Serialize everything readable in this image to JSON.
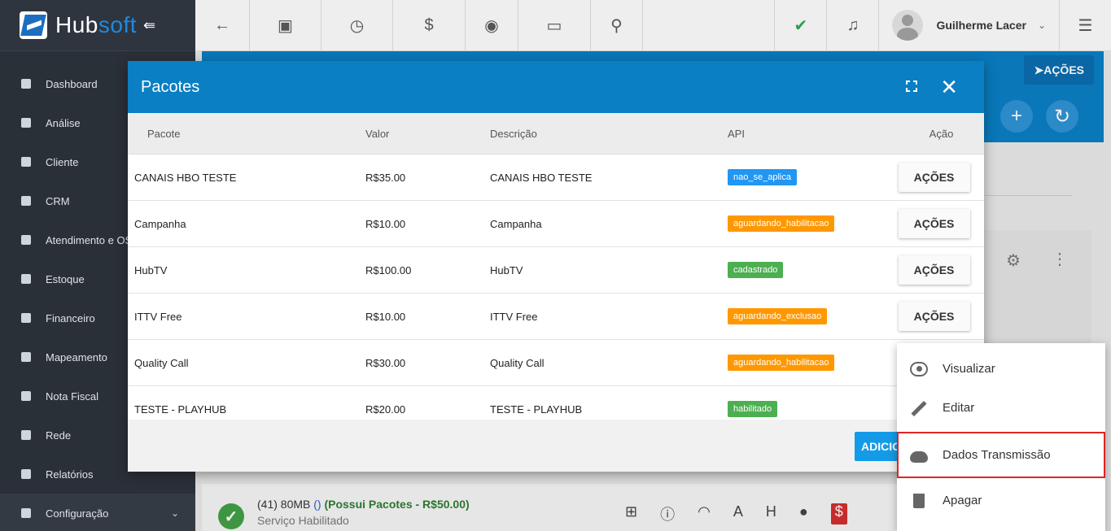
{
  "brand": {
    "name_part1": "Hub",
    "name_part2": "soft",
    "collapse_icon": "⇚"
  },
  "sidebar": {
    "items": [
      {
        "label": "Dashboard",
        "icon": "dashboard-icon"
      },
      {
        "label": "Análise",
        "icon": "pie-chart-icon"
      },
      {
        "label": "Cliente",
        "icon": "contact-card-icon"
      },
      {
        "label": "CRM",
        "icon": "crm-board-icon"
      },
      {
        "label": "Atendimento e OS",
        "icon": "calendar-clock-icon"
      },
      {
        "label": "Estoque",
        "icon": "box-icon"
      },
      {
        "label": "Financeiro",
        "icon": "money-icon"
      },
      {
        "label": "Mapeamento",
        "icon": "map-pin-icon"
      },
      {
        "label": "Nota Fiscal",
        "icon": "document-icon"
      },
      {
        "label": "Rede",
        "icon": "server-icon"
      },
      {
        "label": "Relatórios",
        "icon": "report-icon"
      },
      {
        "label": "Configuração",
        "icon": "gear-icon"
      }
    ]
  },
  "topbar": {
    "user_name": "Guilherme Lacer",
    "icons": {
      "back": "←",
      "contact": "▣",
      "calendar": "◷",
      "money": "$",
      "eye": "◉",
      "terminal": "▭",
      "search": "⚲",
      "check": "✔",
      "bell": "♫",
      "menu": "☰",
      "caret": "⌄"
    }
  },
  "background": {
    "acoes_label": "AÇÕES",
    "service": {
      "title_main": "(41) 80MB",
      "title_paren": "()",
      "title_packages": "(Possui Pacotes - R$50.00)",
      "subtitle": "Serviço Habilitado"
    }
  },
  "modal": {
    "title": "Pacotes",
    "columns": [
      "Pacote",
      "Valor",
      "Descrição",
      "API",
      "Ação"
    ],
    "rows": [
      {
        "pacote": "CANAIS HBO TESTE",
        "valor": "R$35.00",
        "descricao": "CANAIS HBO TESTE",
        "api": "nao_se_aplica",
        "api_color": "#2196f3",
        "acao": "AÇÕES"
      },
      {
        "pacote": "Campanha",
        "valor": "R$10.00",
        "descricao": "Campanha",
        "api": "aguardando_habilitacao",
        "api_color": "#ff9800",
        "acao": "AÇÕES"
      },
      {
        "pacote": "HubTV",
        "valor": "R$100.00",
        "descricao": "HubTV",
        "api": "cadastrado",
        "api_color": "#4caf50",
        "acao": "AÇÕES"
      },
      {
        "pacote": "ITTV Free",
        "valor": "R$10.00",
        "descricao": "ITTV Free",
        "api": "aguardando_exclusao",
        "api_color": "#ff9800",
        "acao": "AÇÕES"
      },
      {
        "pacote": "Quality Call",
        "valor": "R$30.00",
        "descricao": "Quality Call",
        "api": "aguardando_habilitacao",
        "api_color": "#ff9800",
        "acao": ""
      },
      {
        "pacote": "TESTE - PLAYHUB",
        "valor": "R$20.00",
        "descricao": "TESTE - PLAYHUB",
        "api": "habilitado",
        "api_color": "#4caf50",
        "acao": ""
      }
    ],
    "add_button_label": "ADICIO"
  },
  "context_menu": {
    "items": [
      {
        "label": "Visualizar",
        "icon": "eye-icon"
      },
      {
        "label": "Editar",
        "icon": "pencil-icon"
      },
      {
        "label": "Dados Transmissão",
        "icon": "cloud-upload-icon",
        "highlighted": true
      },
      {
        "label": "Apagar",
        "icon": "trash-icon"
      }
    ]
  }
}
